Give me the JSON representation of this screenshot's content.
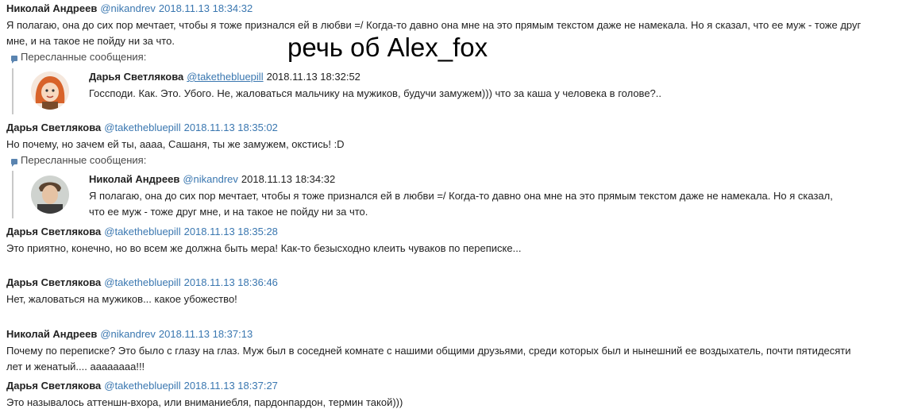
{
  "overlay_text": "речь об Alex_fox",
  "forwarded_label": "Пересланные сообщения:",
  "messages": [
    {
      "author": "Николай Андреев",
      "handle": "@nikandrev",
      "timestamp": "2018.11.13 18:34:32",
      "text": "Я полагаю, она до сих пор мечтает, чтобы я тоже признался ей в любви =/ Когда-то давно она мне на это прямым текстом даже не намекала. Но я сказал, что ее муж - тоже друг мне, и на такое не пойду ни за что.",
      "forwarded": {
        "author": "Дарья Светлякова",
        "handle": "@takethebluepill",
        "timestamp": "2018.11.13 18:32:52",
        "text": "Госсподи. Как. Это. Убого. Не, жаловаться мальчику на мужиков, будучи замужем))) что за каша у человека в голове?.."
      }
    },
    {
      "author": "Дарья Светлякова",
      "handle": "@takethebluepill",
      "timestamp": "2018.11.13 18:35:02",
      "text": "Но почему, но зачем ей ты, аааа, Сашаня, ты же замужем, окстись! :D",
      "forwarded": {
        "author": "Николай Андреев",
        "handle": "@nikandrev",
        "timestamp": "2018.11.13 18:34:32",
        "text": "Я полагаю, она до сих пор мечтает, чтобы я тоже признался ей в любви =/ Когда-то давно она мне на это прямым текстом даже не намекала. Но я сказал, что ее муж - тоже друг мне, и на такое не пойду ни за что."
      }
    },
    {
      "author": "Дарья Светлякова",
      "handle": "@takethebluepill",
      "timestamp": "2018.11.13 18:35:28",
      "text": "Это приятно, конечно, но во всем же должна быть мера! Как-то безысходно клеить чуваков по переписке..."
    },
    {
      "author": "Дарья Светлякова",
      "handle": "@takethebluepill",
      "timestamp": "2018.11.13 18:36:46",
      "text": "Нет, жаловаться на мужиков... какое убожество!"
    },
    {
      "author": "Николай Андреев",
      "handle": "@nikandrev",
      "timestamp": "2018.11.13 18:37:13",
      "text": "Почему по переписке? Это было с глазу на глаз. Муж был в соседней комнате с нашими общими друзьями, среди которых был и нынешний ее воздыхатель, почти пятидесяти лет и женатый.... аааааааа!!!"
    },
    {
      "author": "Дарья Светлякова",
      "handle": "@takethebluepill",
      "timestamp": "2018.11.13 18:37:27",
      "text": "Это называлось аттеншн-вхора, или вниманиебля, пардонпардон, термин такой)))"
    }
  ]
}
